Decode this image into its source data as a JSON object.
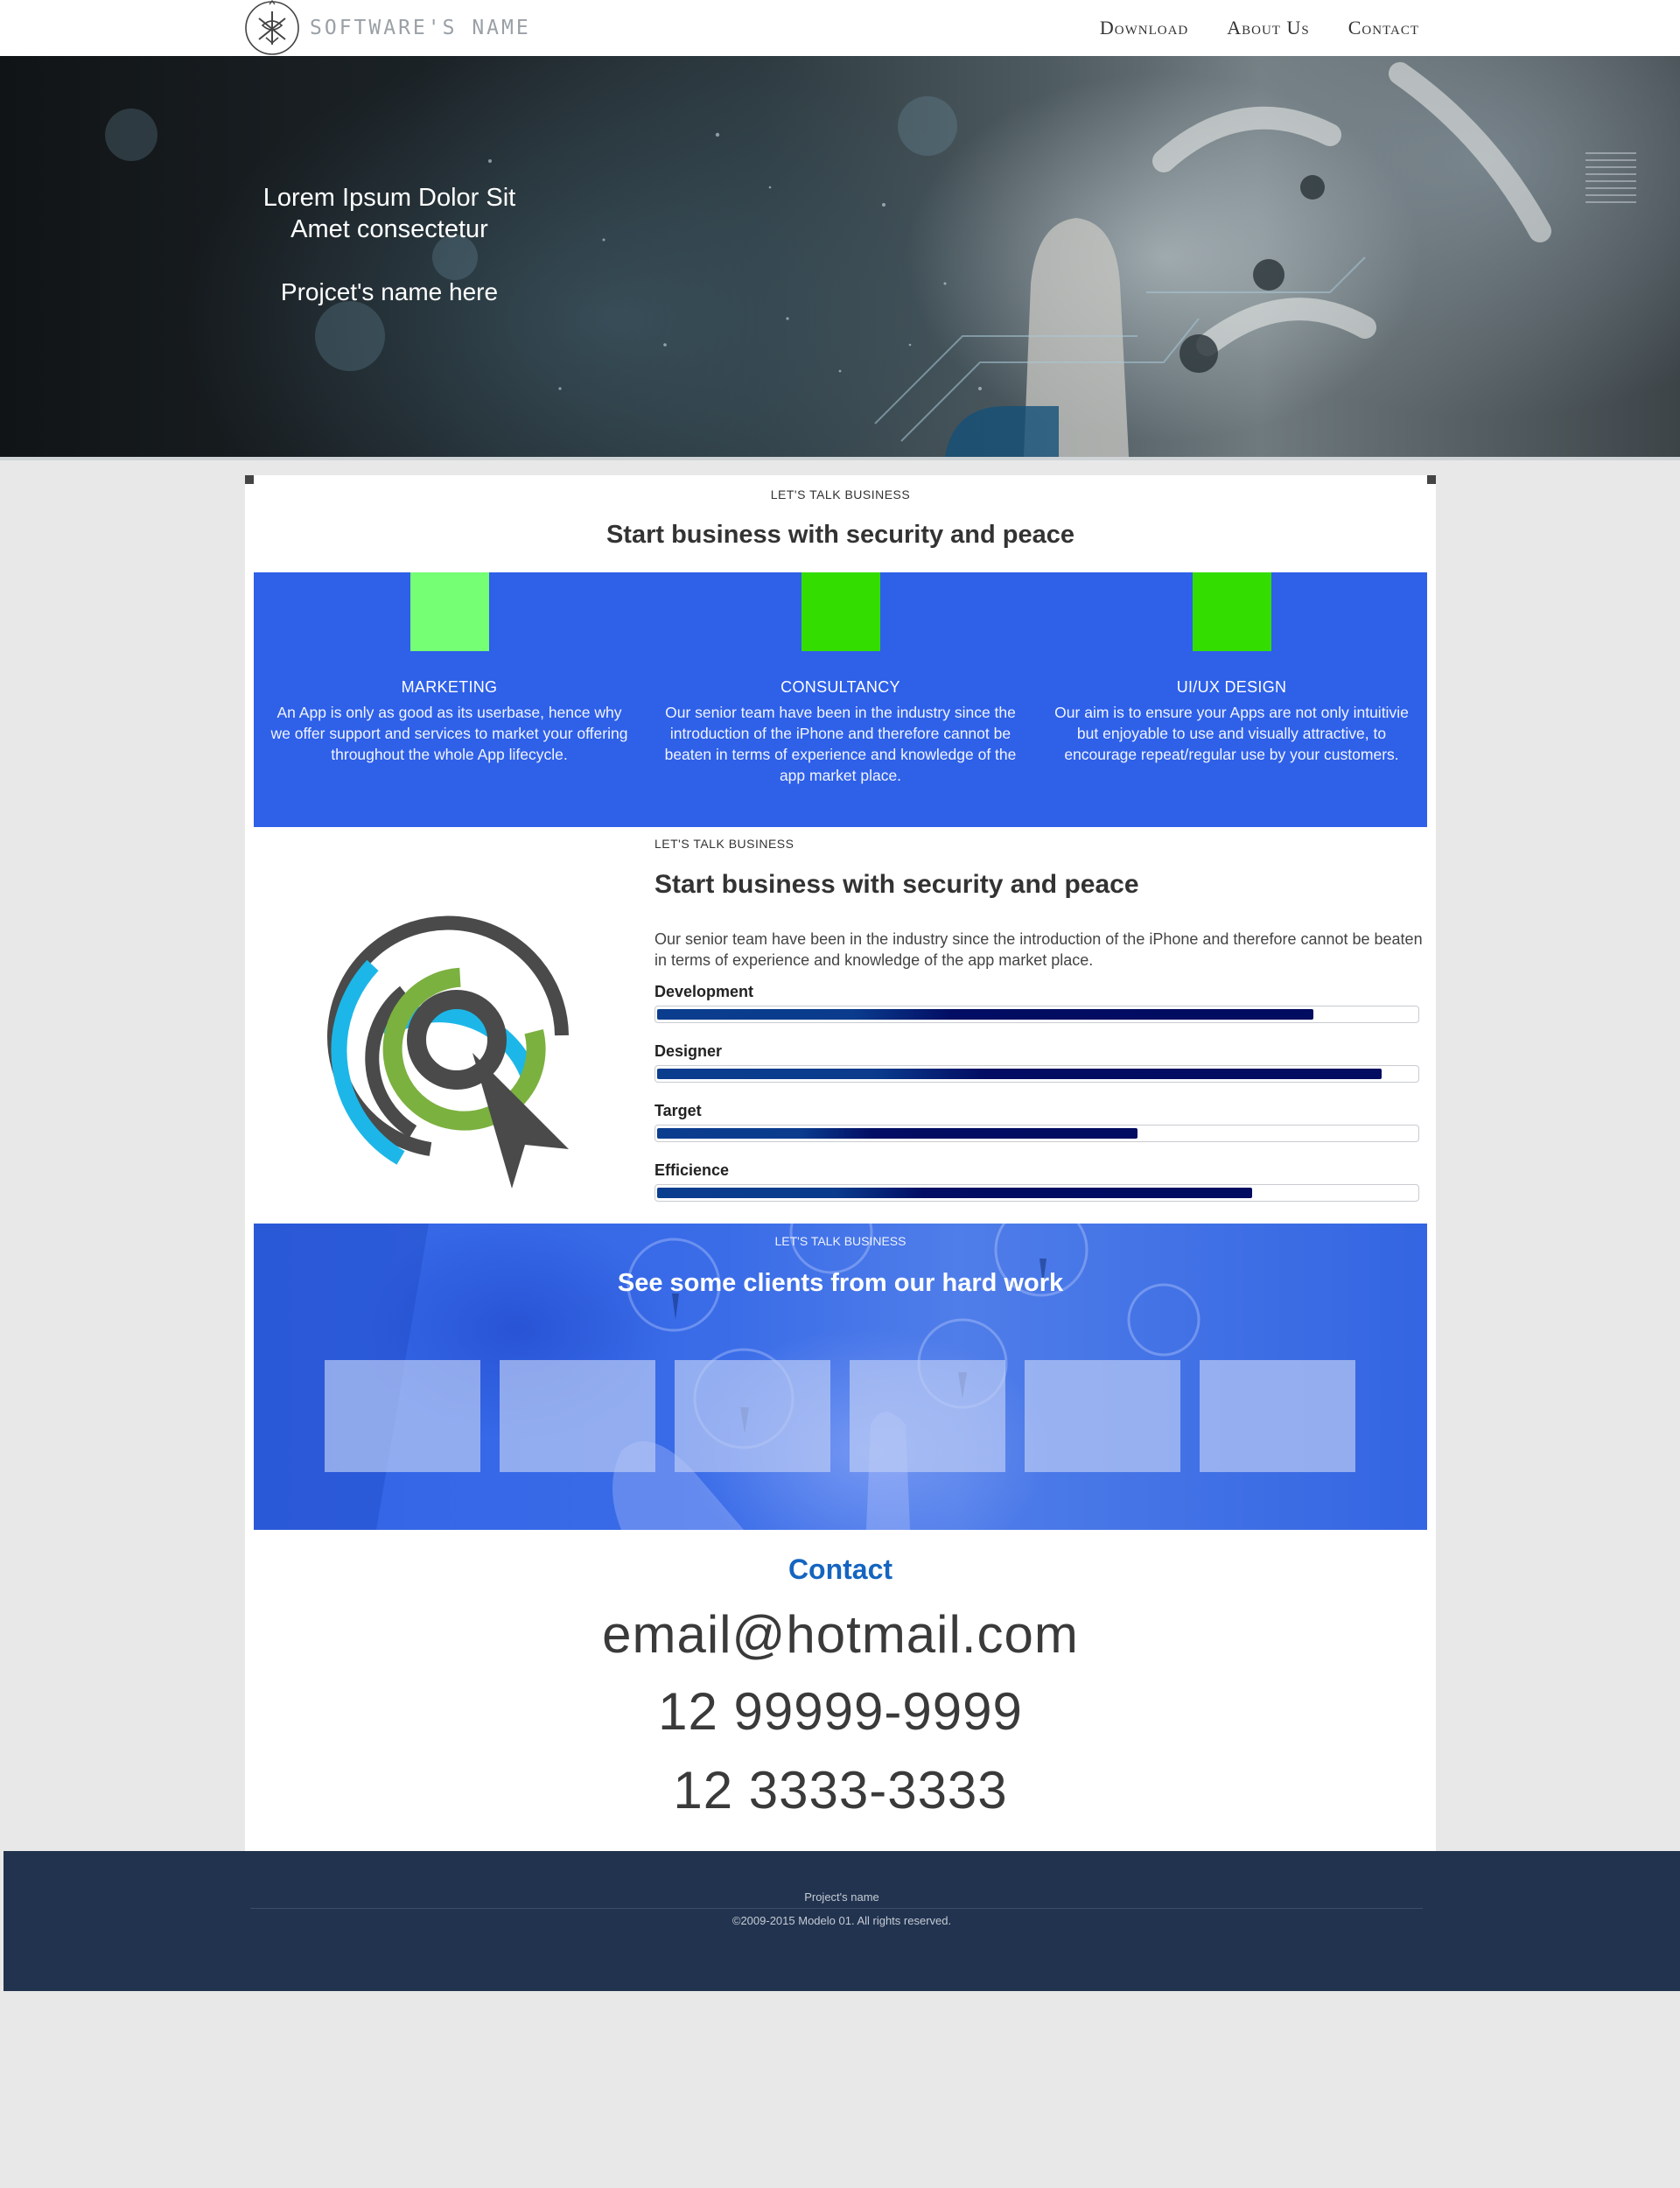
{
  "header": {
    "logo_text": "Software's name",
    "nav": [
      {
        "label": "Download"
      },
      {
        "label": "About Us"
      },
      {
        "label": "Contact"
      }
    ]
  },
  "hero": {
    "title_line1": "Lorem Ipsum Dolor Sit",
    "title_line2": "Amet consectetur",
    "subtitle": "Projcet's name here"
  },
  "intro": {
    "eyebrow": "Let's talk business",
    "title": "Start business with security and peace"
  },
  "services": [
    {
      "title": "Marketing",
      "text": "An App is only as good as its userbase, hence why we offer support and services to market your offering throughout the whole App lifecycle.",
      "color": "#74ff74"
    },
    {
      "title": "Consultancy",
      "text": "Our senior team have been in the industry since the introduction of the iPhone and therefore cannot be beaten in terms of experience and knowledge of the app market place.",
      "color": "#33dd00"
    },
    {
      "title": "UI/UX Design",
      "text": "Our aim is to ensure your Apps are not only intuitivie but enjoyable to use and visually attractive, to encourage repeat/regular use by your customers.",
      "color": "#33dd00"
    }
  ],
  "skills": {
    "eyebrow": "Let's talk business",
    "title": "Start business with security and peace",
    "description": "Our senior team have been in the industry since the introduction of the iPhone and therefore cannot be beaten in terms of experience and knowledge of the app market place.",
    "items": [
      {
        "label": "Development",
        "level": 0.86
      },
      {
        "label": "Designer",
        "level": 0.95
      },
      {
        "label": "Target",
        "level": 0.63
      },
      {
        "label": "Efficience",
        "level": 0.78
      }
    ]
  },
  "clients": {
    "eyebrow": "Let's talk business",
    "title": "See some clients from our hard work",
    "logo_count": 6
  },
  "contact": {
    "title": "Contact",
    "email": "email@hotmail.com",
    "phone1": "12 99999-9999",
    "phone2": "12 3333-3333"
  },
  "footer": {
    "project_name": "Project's name",
    "copyright": "©2009-2015 Modelo 01. All rights reserved."
  },
  "colors": {
    "accent_blue": "#2e60e8",
    "contact_blue": "#1565c0",
    "footer_bg": "#21334f",
    "bar_fill": "#020c60"
  }
}
